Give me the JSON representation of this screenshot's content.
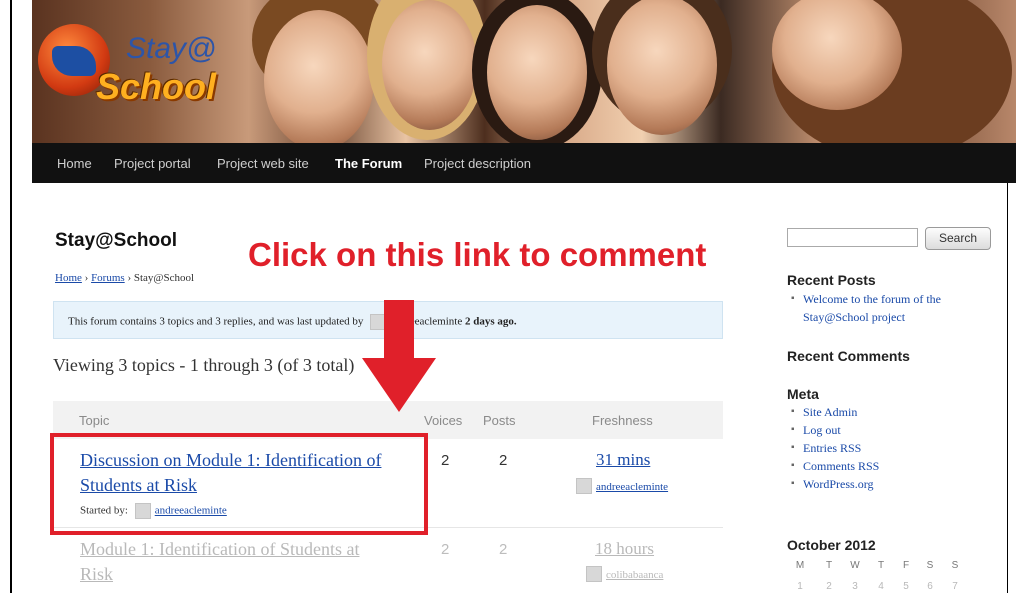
{
  "header": {
    "logo_top": "Stay@",
    "logo_bottom": "School"
  },
  "nav": {
    "items": [
      {
        "label": "Home",
        "active": false
      },
      {
        "label": "Project portal",
        "active": false
      },
      {
        "label": "Project web site",
        "active": false
      },
      {
        "label": "The Forum",
        "active": true
      },
      {
        "label": "Project description",
        "active": false
      }
    ]
  },
  "main": {
    "forum_title": "Stay@School",
    "breadcrumb": {
      "home": "Home",
      "sep": "›",
      "forums": "Forums",
      "current": "Stay@School"
    },
    "info_box": {
      "text_before": "This forum contains 3 topics and 3 replies, and was last updated by",
      "user": "andreeaclemintе",
      "text_after": "2 days ago."
    },
    "viewing": "Viewing 3 topics - 1 through 3 (of 3 total)",
    "table": {
      "headers": {
        "topic": "Topic",
        "voices": "Voices",
        "posts": "Posts",
        "freshness": "Freshness"
      },
      "rows": [
        {
          "title_line1": "Discussion on Module 1: Identification of",
          "title_line2": "Students at Risk",
          "started_label": "Started by:",
          "started_user": "andreeaclemintе",
          "voices": "2",
          "posts": "2",
          "freshness": "31 mins",
          "fresh_user": "andreeaclemintе"
        },
        {
          "title_line1": "Module 1: Identification of Students at",
          "title_line2": "Risk",
          "voices": "2",
          "posts": "2",
          "freshness": "18 hours",
          "fresh_user": "colibabaanca"
        }
      ]
    }
  },
  "annotation": {
    "text": "Click on this link to comment",
    "color": "#e0202a"
  },
  "sidebar": {
    "search": {
      "placeholder": "",
      "button": "Search"
    },
    "recent_posts": {
      "heading": "Recent Posts",
      "items": [
        "Welcome to the forum of the Stay@School project"
      ]
    },
    "recent_comments": {
      "heading": "Recent Comments"
    },
    "meta": {
      "heading": "Meta",
      "items": [
        "Site Admin",
        "Log out",
        "Entries RSS",
        "Comments RSS",
        "WordPress.org"
      ]
    },
    "calendar": {
      "title": "October 2012",
      "weekdays": [
        "M",
        "T",
        "W",
        "T",
        "F",
        "S",
        "S"
      ],
      "first_row": [
        "1",
        "2",
        "3",
        "4",
        "5",
        "6",
        "7"
      ]
    }
  }
}
